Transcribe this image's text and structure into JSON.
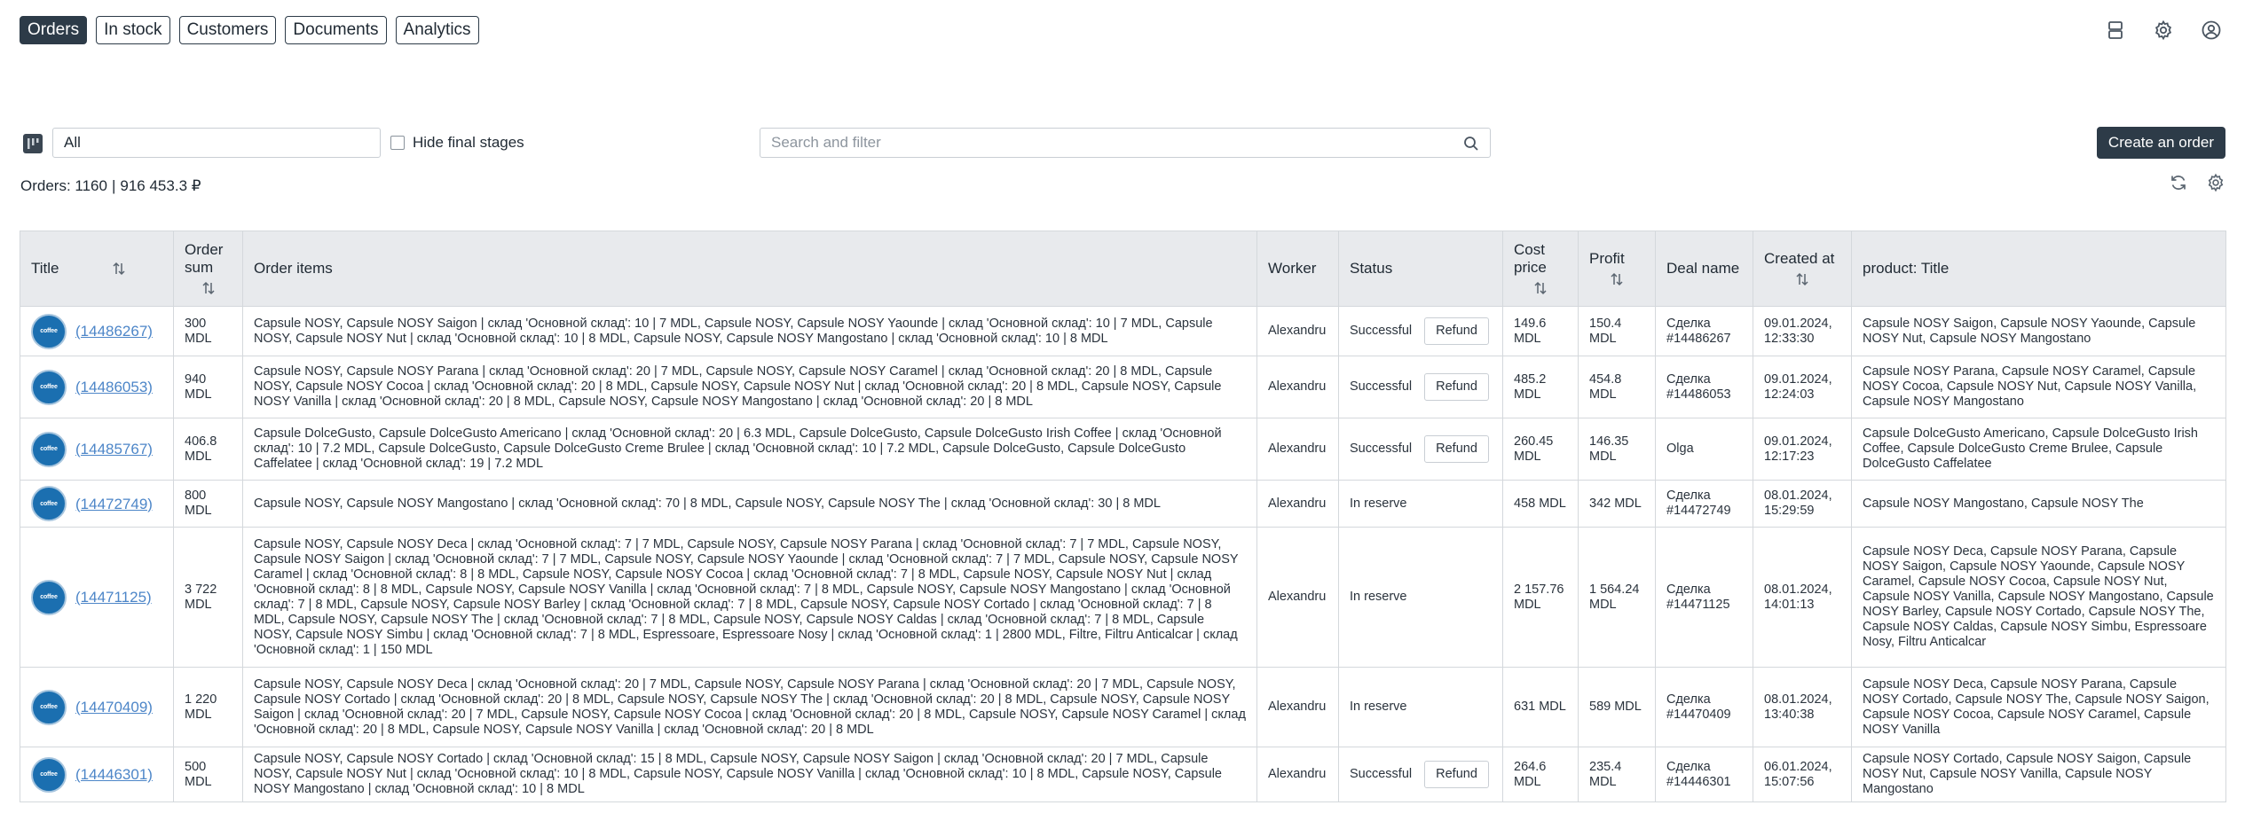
{
  "nav": {
    "tabs": [
      {
        "label": "Orders",
        "active": true
      },
      {
        "label": "In stock",
        "active": false
      },
      {
        "label": "Customers",
        "active": false
      },
      {
        "label": "Documents",
        "active": false
      },
      {
        "label": "Analytics",
        "active": false
      }
    ],
    "icons": [
      "layout-icon",
      "gear-icon",
      "user-account-icon"
    ]
  },
  "filters": {
    "stage_value": "All",
    "hide_final_label": "Hide final stages",
    "hide_final_checked": false,
    "search_placeholder": "Search and filter",
    "search_value": ""
  },
  "create_button": "Create an order",
  "summary": {
    "orders_label": "Orders: 1160",
    "separator": "|",
    "total": "916 453.3 ₽"
  },
  "table": {
    "headers": {
      "title": "Title",
      "order_sum": "Order sum",
      "order_items": "Order items",
      "worker": "Worker",
      "status": "Status",
      "cost_price": "Cost price",
      "profit": "Profit",
      "deal_name": "Deal name",
      "created_at": "Created at",
      "product_title": "product: Title"
    },
    "refund_label": "Refund",
    "avatar_text": "coffee",
    "rows": [
      {
        "id": "(14486267)",
        "sum": "300 MDL",
        "items": "Capsule NOSY, Capsule NOSY Saigon | склад 'Основной склад': 10 | 7 MDL, Capsule NOSY, Capsule NOSY Yaounde | склад 'Основной склад': 10 | 7 MDL, Capsule NOSY, Capsule NOSY Nut | склад 'Основной склад': 10 | 8 MDL, Capsule NOSY, Capsule NOSY Mangostano | склад 'Основной склад': 10 | 8 MDL",
        "worker": "Alexandru",
        "status": "Successful",
        "refund": true,
        "cost": "149.6 MDL",
        "profit": "150.4 MDL",
        "deal": "Сделка #14486267",
        "created": "09.01.2024, 12:33:30",
        "product": "Capsule NOSY Saigon, Capsule NOSY Yaounde, Capsule NOSY Nut, Capsule NOSY Mangostano"
      },
      {
        "id": "(14486053)",
        "sum": "940 MDL",
        "items": "Capsule NOSY, Capsule NOSY Parana | склад 'Основной склад': 20 | 7 MDL, Capsule NOSY, Capsule NOSY Caramel | склад 'Основной склад': 20 | 8 MDL, Capsule NOSY, Capsule NOSY Cocoa | склад 'Основной склад': 20 | 8 MDL, Capsule NOSY, Capsule NOSY Nut | склад 'Основной склад': 20 | 8 MDL, Capsule NOSY, Capsule NOSY Vanilla | склад 'Основной склад': 20 | 8 MDL, Capsule NOSY, Capsule NOSY Mangostano | склад 'Основной склад': 20 | 8 MDL",
        "worker": "Alexandru",
        "status": "Successful",
        "refund": true,
        "cost": "485.2 MDL",
        "profit": "454.8 MDL",
        "deal": "Сделка #14486053",
        "created": "09.01.2024, 12:24:03",
        "product": "Capsule NOSY Parana, Capsule NOSY Caramel, Capsule NOSY Cocoa, Capsule NOSY Nut, Capsule NOSY Vanilla, Capsule NOSY Mangostano"
      },
      {
        "id": "(14485767)",
        "sum": "406.8 MDL",
        "items": "Capsule DolceGusto, Capsule DolceGusto Americano | склад 'Основной склад': 20 | 6.3 MDL, Capsule DolceGusto, Capsule DolceGusto Irish Coffee | склад 'Основной склад': 10 | 7.2 MDL, Capsule DolceGusto, Capsule DolceGusto Creme Brulee | склад 'Основной склад': 10 | 7.2 MDL, Capsule DolceGusto, Capsule DolceGusto Caffelatee | склад 'Основной склад': 19 | 7.2 MDL",
        "worker": "Alexandru",
        "status": "Successful",
        "refund": true,
        "cost": "260.45 MDL",
        "profit": "146.35 MDL",
        "deal": "Olga",
        "created": "09.01.2024, 12:17:23",
        "product": "Capsule DolceGusto Americano, Capsule DolceGusto Irish Coffee, Capsule DolceGusto Creme Brulee, Capsule DolceGusto Caffelatee"
      },
      {
        "id": "(14472749)",
        "sum": "800 MDL",
        "items": "Capsule NOSY, Capsule NOSY Mangostano | склад 'Основной склад': 70 | 8 MDL, Capsule NOSY, Capsule NOSY The | склад 'Основной склад': 30 | 8 MDL",
        "worker": "Alexandru",
        "status": "In reserve",
        "refund": false,
        "cost": "458 MDL",
        "profit": "342 MDL",
        "deal": "Сделка #14472749",
        "created": "08.01.2024, 15:29:59",
        "product": "Capsule NOSY Mangostano, Capsule NOSY The"
      },
      {
        "id": "(14471125)",
        "sum": "3 722 MDL",
        "items": "Capsule NOSY, Capsule NOSY Deca | склад 'Основной склад': 7 | 7 MDL, Capsule NOSY, Capsule NOSY Parana | склад 'Основной склад': 7 | 7 MDL, Capsule NOSY, Capsule NOSY Saigon | склад 'Основной склад': 7 | 7 MDL, Capsule NOSY, Capsule NOSY Yaounde | склад 'Основной склад': 7 | 7 MDL, Capsule NOSY, Capsule NOSY Caramel | склад 'Основной склад': 8 | 8 MDL, Capsule NOSY, Capsule NOSY Cocoa | склад 'Основной склад': 7 | 8 MDL, Capsule NOSY, Capsule NOSY Nut | склад 'Основной склад': 8 | 8 MDL, Capsule NOSY, Capsule NOSY Vanilla | склад 'Основной склад': 7 | 8 MDL, Capsule NOSY, Capsule NOSY Mangostano | склад 'Основной склад': 7 | 8 MDL, Capsule NOSY, Capsule NOSY Barley | склад 'Основной склад': 7 | 8 MDL, Capsule NOSY, Capsule NOSY Cortado | склад 'Основной склад': 7 | 8 MDL, Capsule NOSY, Capsule NOSY The | склад 'Основной склад': 7 | 8 MDL, Capsule NOSY, Capsule NOSY Caldas | склад 'Основной склад': 7 | 8 MDL, Capsule NOSY, Capsule NOSY Simbu | склад 'Основной склад': 7 | 8 MDL, Espressoare, Espressoare Nosy | склад 'Основной склад': 1 | 2800 MDL, Filtre, Filtru Anticalcar | склад 'Основной склад': 1 | 150 MDL",
        "worker": "Alexandru",
        "status": "In reserve",
        "refund": false,
        "cost": "2 157.76 MDL",
        "profit": "1 564.24 MDL",
        "deal": "Сделка #14471125",
        "created": "08.01.2024, 14:01:13",
        "product": "Capsule NOSY Deca, Capsule NOSY Parana, Capsule NOSY Saigon, Capsule NOSY Yaounde, Capsule NOSY Caramel, Capsule NOSY Cocoa, Capsule NOSY Nut, Capsule NOSY Vanilla, Capsule NOSY Mangostano, Capsule NOSY Barley, Capsule NOSY Cortado, Capsule NOSY The, Capsule NOSY Caldas, Capsule NOSY Simbu, Espressoare Nosy, Filtru Anticalcar"
      },
      {
        "id": "(14470409)",
        "sum": "1 220 MDL",
        "items": "Capsule NOSY, Capsule NOSY Deca | склад 'Основной склад': 20 | 7 MDL, Capsule NOSY, Capsule NOSY Parana | склад 'Основной склад': 20 | 7 MDL, Capsule NOSY, Capsule NOSY Cortado | склад 'Основной склад': 20 | 8 MDL, Capsule NOSY, Capsule NOSY The | склад 'Основной склад': 20 | 8 MDL, Capsule NOSY, Capsule NOSY Saigon | склад 'Основной склад': 20 | 7 MDL, Capsule NOSY, Capsule NOSY Cocoa | склад 'Основной склад': 20 | 8 MDL, Capsule NOSY, Capsule NOSY Caramel | склад 'Основной склад': 20 | 8 MDL, Capsule NOSY, Capsule NOSY Vanilla | склад 'Основной склад': 20 | 8 MDL",
        "worker": "Alexandru",
        "status": "In reserve",
        "refund": false,
        "cost": "631 MDL",
        "profit": "589 MDL",
        "deal": "Сделка #14470409",
        "created": "08.01.2024, 13:40:38",
        "product": "Capsule NOSY Deca, Capsule NOSY Parana, Capsule NOSY Cortado, Capsule NOSY The, Capsule NOSY Saigon, Capsule NOSY Cocoa, Capsule NOSY Caramel, Capsule NOSY Vanilla"
      },
      {
        "id": "(14446301)",
        "sum": "500 MDL",
        "items": "Capsule NOSY, Capsule NOSY Cortado | склад 'Основной склад': 15 | 8 MDL, Capsule NOSY, Capsule NOSY Saigon | склад 'Основной склад': 20 | 7 MDL, Capsule NOSY, Capsule NOSY Nut | склад 'Основной склад': 10 | 8 MDL, Capsule NOSY, Capsule NOSY Vanilla | склад 'Основной склад': 10 | 8 MDL, Capsule NOSY, Capsule NOSY Mangostano | склад 'Основной склад': 10 | 8 MDL",
        "worker": "Alexandru",
        "status": "Successful",
        "refund": true,
        "cost": "264.6 MDL",
        "profit": "235.4 MDL",
        "deal": "Сделка #14446301",
        "created": "06.01.2024, 15:07:56",
        "product": "Capsule NOSY Cortado, Capsule NOSY Saigon, Capsule NOSY Nut, Capsule NOSY Vanilla, Capsule NOSY Mangostano"
      }
    ]
  }
}
